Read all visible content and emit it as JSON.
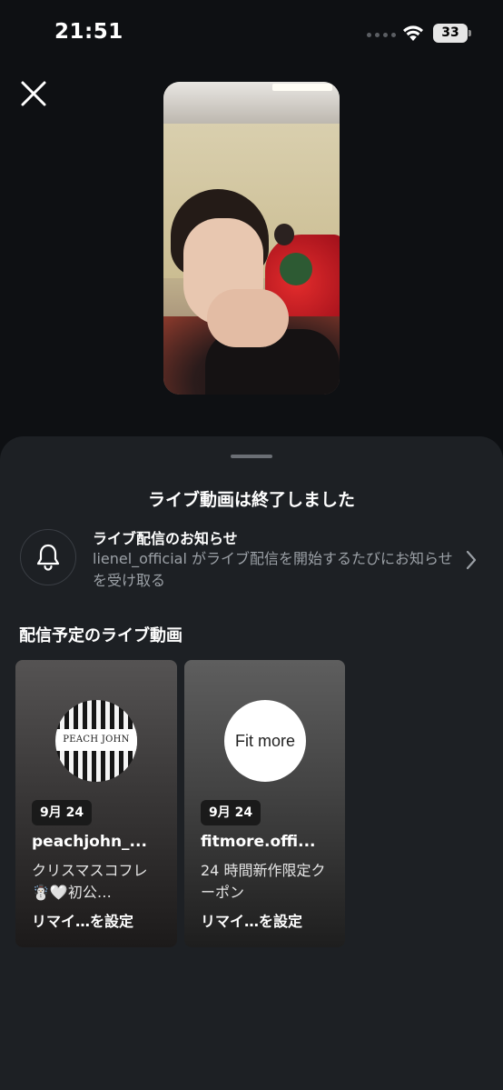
{
  "status_bar": {
    "time": "21:51",
    "battery": "33"
  },
  "icons": {
    "close": "close-icon",
    "bell": "bell-icon",
    "chevron": "chevron-right-icon",
    "wifi": "wifi-icon"
  },
  "sheet": {
    "title": "ライブ動画は終了しました",
    "notify": {
      "title": "ライブ配信のお知らせ",
      "description": "lienel_official がライブ配信を開始するたびにお知らせを受け取る"
    },
    "section_title": "配信予定のライブ動画",
    "cards": [
      {
        "logo_text": "PEACH JOHN",
        "date": "9月 24",
        "username": "peachjohn_...",
        "description": "クリスマスコフレ☃️🤍初公…",
        "remind": "リマイ…を設定"
      },
      {
        "logo_text": "Fit more",
        "date": "9月 24",
        "username": "fitmore.offi...",
        "description": "24 時間新作限定クーポン",
        "remind": "リマイ…を設定"
      }
    ]
  },
  "colors": {
    "background": "#0e1013",
    "sheet": "#1d2024",
    "secondary_text": "#9ba0a6"
  }
}
